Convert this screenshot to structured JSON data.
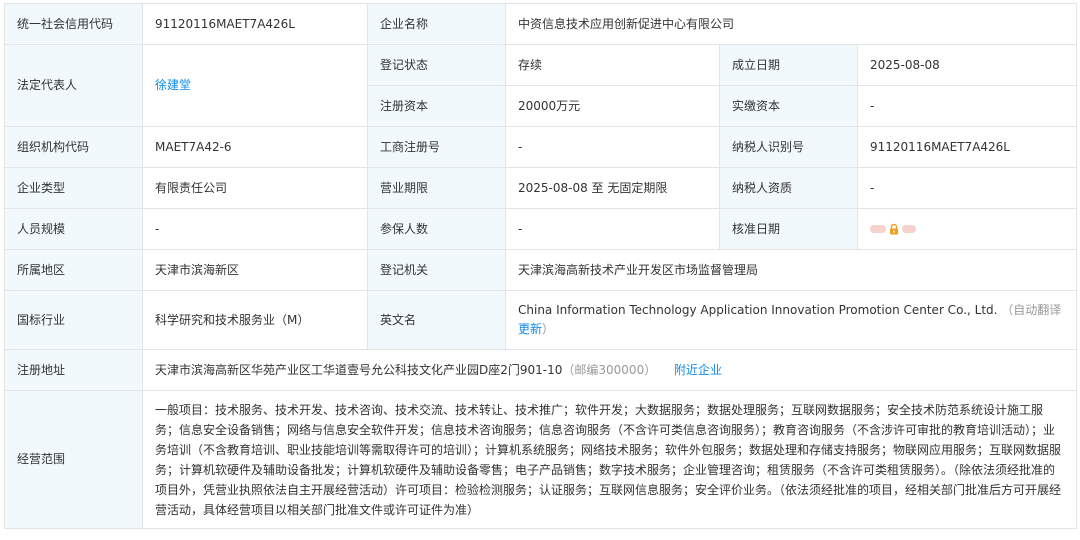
{
  "labels": {
    "credit_code": "统一社会信用代码",
    "company_name": "企业名称",
    "legal_rep": "法定代表人",
    "reg_status": "登记状态",
    "established": "成立日期",
    "reg_capital": "注册资本",
    "paid_capital": "实缴资本",
    "org_code": "组织机构代码",
    "biz_reg_no": "工商注册号",
    "taxpayer_id": "纳税人识别号",
    "company_type": "企业类型",
    "biz_term": "营业期限",
    "taxpayer_qual": "纳税人资质",
    "staff_size": "人员规模",
    "insured_count": "参保人数",
    "approval_date": "核准日期",
    "region": "所属地区",
    "reg_authority": "登记机关",
    "industry": "国标行业",
    "english_name": "英文名",
    "reg_address": "注册地址",
    "biz_scope": "经营范围"
  },
  "values": {
    "credit_code": "91120116MAET7A426L",
    "company_name": "中资信息技术应用创新促进中心有限公司",
    "legal_rep": "徐建堂",
    "reg_status": "存续",
    "established": "2025-08-08",
    "reg_capital": "20000万元",
    "paid_capital": "-",
    "org_code": "MAET7A42-6",
    "biz_reg_no": "-",
    "taxpayer_id": "91120116MAET7A426L",
    "company_type": "有限责任公司",
    "biz_term": "2025-08-08 至 无固定期限",
    "taxpayer_qual": "-",
    "staff_size": "-",
    "insured_count": "-",
    "region": "天津市滨海新区",
    "reg_authority": "天津滨海高新技术产业开发区市场监督管理局",
    "industry": "科学研究和技术服务业（M）",
    "english_name": "China Information Technology Application Innovation Promotion Center Co., Ltd.",
    "english_note": "（自动翻译",
    "english_update": "更新",
    "english_close": "）",
    "reg_address": "天津市滨海高新区华苑产业区工华道壹号允公科技文化产业园D座2门901-10",
    "postcode": "（邮编300000）",
    "nearby_link": "附近企业",
    "biz_scope": "一般项目：技术服务、技术开发、技术咨询、技术交流、技术转让、技术推广；软件开发；大数据服务；数据处理服务；互联网数据服务；安全技术防范系统设计施工服务；信息安全设备销售；网络与信息安全软件开发；信息技术咨询服务；信息咨询服务（不含许可类信息咨询服务）；教育咨询服务（不含涉许可审批的教育培训活动）；业务培训（不含教育培训、职业技能培训等需取得许可的培训）；计算机系统服务；网络技术服务；软件外包服务；数据处理和存储支持服务；物联网应用服务；互联网数据服务；计算机软硬件及辅助设备批发；计算机软硬件及辅助设备零售；电子产品销售；数字技术服务；企业管理咨询；租赁服务（不含许可类租赁服务）。（除依法须经批准的项目外，凭营业执照依法自主开展经营活动）许可项目：检验检测服务；认证服务；互联网信息服务；安全评价业务。（依法须经批准的项目，经相关部门批准后方可开展经营活动，具体经营项目以相关部门批准文件或许可证件为准）"
  },
  "icons": {
    "approval_date_lock": "lock-icon"
  },
  "colors": {
    "label_bg": "#f2f9fc",
    "border": "#e4e4e4",
    "link": "#128bed",
    "lock": "#f0a020"
  }
}
